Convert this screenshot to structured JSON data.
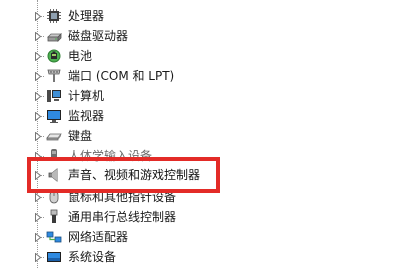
{
  "tree": {
    "nodes": [
      {
        "label": "处理器",
        "icon": "processor-icon"
      },
      {
        "label": "磁盘驱动器",
        "icon": "disk-drive-icon"
      },
      {
        "label": "电池",
        "icon": "battery-icon"
      },
      {
        "label": "端口 (COM 和 LPT)",
        "icon": "port-icon"
      },
      {
        "label": "计算机",
        "icon": "computer-icon"
      },
      {
        "label": "监视器",
        "icon": "monitor-icon"
      },
      {
        "label": "键盘",
        "icon": "keyboard-icon"
      },
      {
        "label": "人体学输入设备",
        "icon": "hid-icon"
      },
      {
        "label": "声音、视频和游戏控制器",
        "icon": "speaker-icon"
      },
      {
        "label": "鼠标和其他指针设备",
        "icon": "mouse-icon"
      },
      {
        "label": "通用串行总线控制器",
        "icon": "usb-icon"
      },
      {
        "label": "网络适配器",
        "icon": "network-adapter-icon"
      },
      {
        "label": "系统设备",
        "icon": "system-devices-icon"
      }
    ]
  },
  "highlight": {
    "color": "#e32b27"
  }
}
